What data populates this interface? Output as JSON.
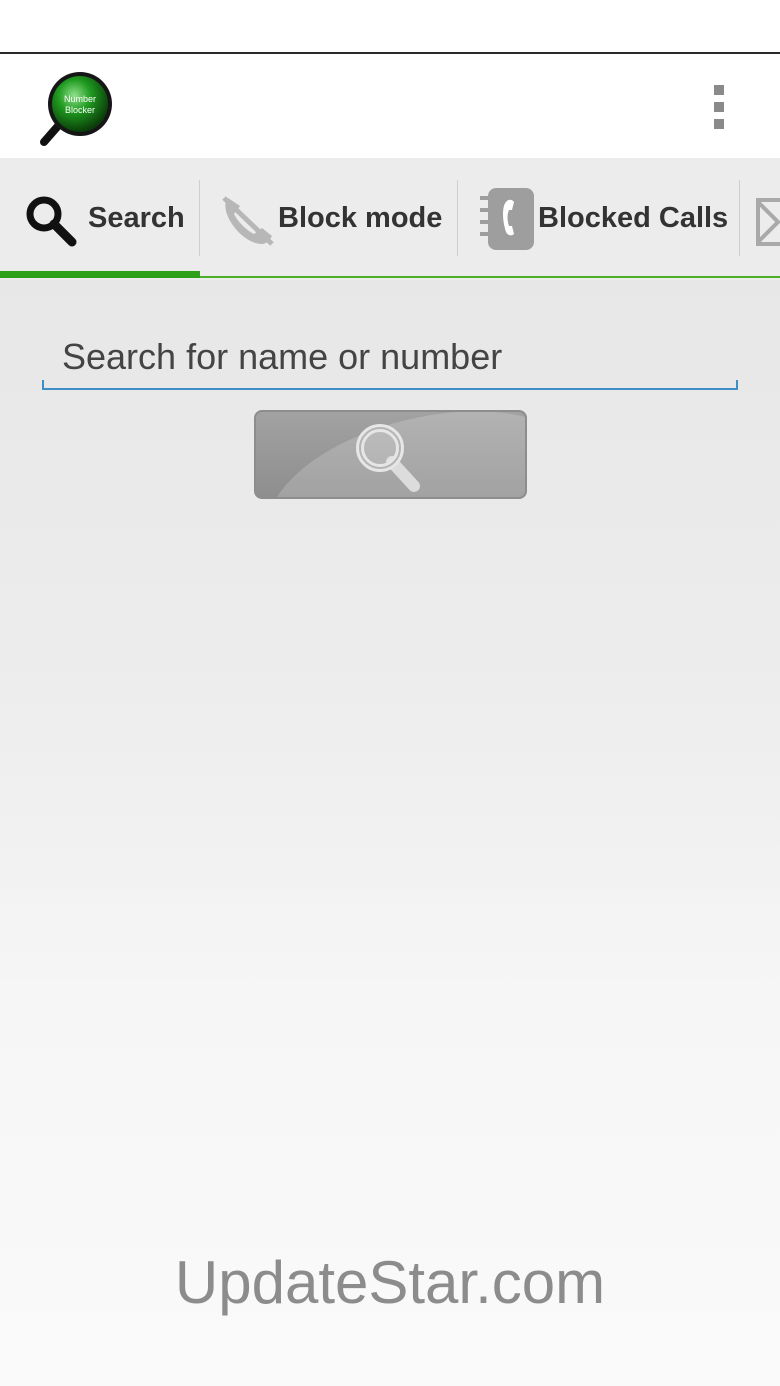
{
  "app": {
    "logo_text_line1": "Number",
    "logo_text_line2": "Blocker",
    "logo_icon": "magnifier-logo-icon",
    "menu_icon": "overflow-menu-icon"
  },
  "tabs": [
    {
      "label": "Search",
      "icon": "search-icon",
      "active": true
    },
    {
      "label": "Block mode",
      "icon": "phone-crossed-icon",
      "active": false
    },
    {
      "label": "Blocked Calls",
      "icon": "call-log-icon",
      "active": false
    },
    {
      "label": "",
      "icon": "message-icon",
      "active": false
    }
  ],
  "search": {
    "placeholder": "Search for name or number",
    "value": "",
    "button_icon": "search-icon"
  },
  "watermark": "UpdateStar.com",
  "colors": {
    "accent_green": "#2ea01a",
    "input_underline": "#3f8fc7",
    "button_gray": "#999999"
  }
}
